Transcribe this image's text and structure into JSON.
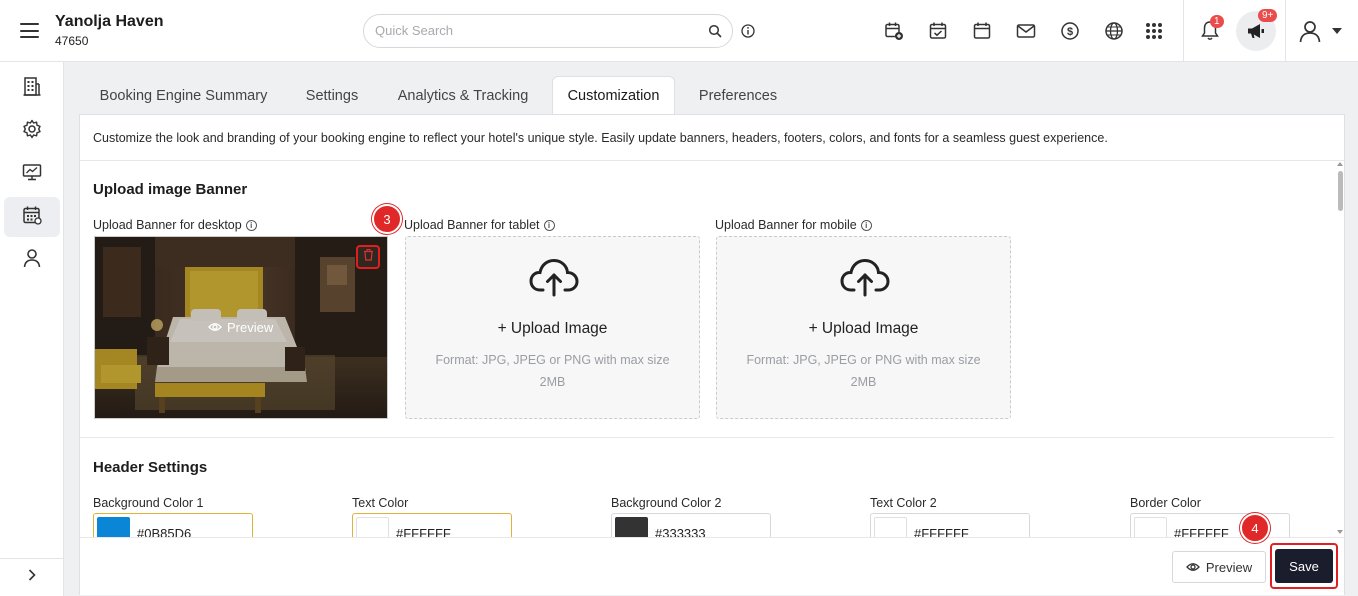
{
  "header": {
    "hotel_name": "Yanolja Haven",
    "hotel_id": "47650",
    "search_placeholder": "Quick Search",
    "notification_count": "1",
    "announcement_count": "9+"
  },
  "tabs": [
    {
      "label": "Booking Engine Summary"
    },
    {
      "label": "Settings"
    },
    {
      "label": "Analytics & Tracking"
    },
    {
      "label": "Customization"
    },
    {
      "label": "Preferences"
    }
  ],
  "main": {
    "description": "Customize the look and branding of your booking engine to reflect your hotel's unique style. Easily update banners, headers, footers, colors, and fonts for a seamless guest experience.",
    "banner_section": {
      "title": "Upload image Banner",
      "desktop_label": "Upload Banner for desktop",
      "tablet_label": "Upload Banner for tablet",
      "mobile_label": "Upload Banner for mobile",
      "preview_label": "Preview",
      "upload_title": "Upload Image",
      "upload_hint": "Format: JPG, JPEG or PNG with max size 2MB"
    },
    "header_section": {
      "title": "Header Settings",
      "colors": [
        {
          "label": "Background Color 1",
          "value": "#0B85D6",
          "swatch": "#0b85d6"
        },
        {
          "label": "Text Color",
          "value": "#FFFFFF",
          "swatch": "#ffffff"
        },
        {
          "label": "Background Color 2",
          "value": "#333333",
          "swatch": "#333333"
        },
        {
          "label": "Text Color 2",
          "value": "#FFFFFF",
          "swatch": "#ffffff"
        },
        {
          "label": "Border Color",
          "value": "#FFFFFF",
          "swatch": "#ffffff"
        }
      ]
    }
  },
  "footer": {
    "preview_label": "Preview",
    "save_label": "Save"
  },
  "steps": {
    "step_delete": "3",
    "step_save": "4"
  },
  "colors": {
    "accent_red": "#e02020",
    "save_bg": "#1a1d2b",
    "focus_border": "#e1b23a"
  }
}
